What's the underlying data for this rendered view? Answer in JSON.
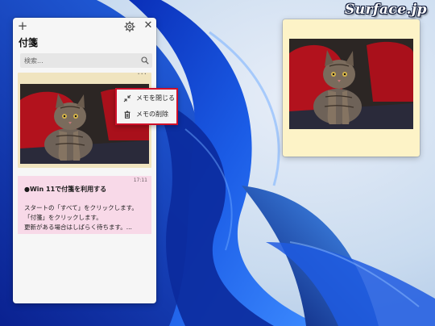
{
  "watermark": "Surface.jp",
  "sticky_list": {
    "title": "付箋",
    "add_icon": "plus-icon",
    "settings_icon": "gear-icon",
    "close_icon": "close-icon",
    "search": {
      "placeholder": "検索...",
      "icon": "search-icon"
    }
  },
  "image_note": {
    "more_icon": "ellipsis-icon",
    "photo": "kitten-on-red-chair"
  },
  "context_menu": {
    "items": [
      {
        "label": "メモを閉じる",
        "icon": "collapse-arrows-icon"
      },
      {
        "label": "メモの削除",
        "icon": "trash-icon"
      }
    ],
    "highlight_color": "#d0102a"
  },
  "text_note": {
    "time": "17:11",
    "heading": "●Win 11で付箋を利用する",
    "lines": [
      "スタートの「すべて」をクリックします。",
      "「付箋」をクリックします。",
      "更新がある場合はしばらく待ちます。..."
    ],
    "color": "#f8d9e8"
  },
  "open_note_window": {
    "photo": "kitten-on-red-chair",
    "color": "#fdf3c7"
  }
}
